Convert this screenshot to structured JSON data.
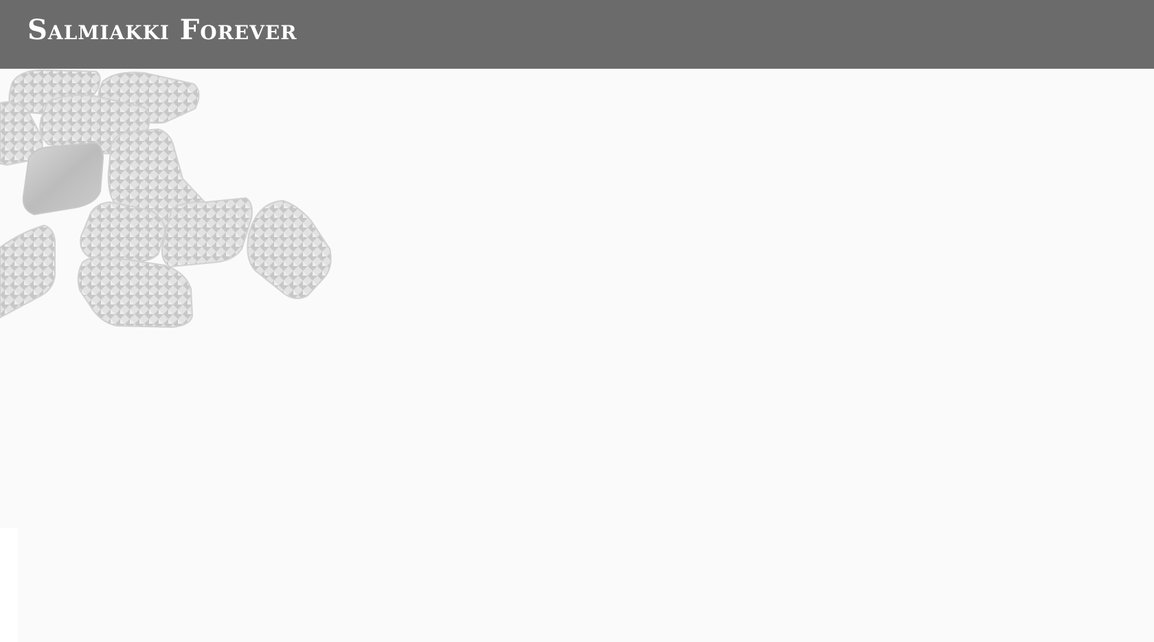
{
  "header": {
    "title": "Salmiakki Forever",
    "background_color": "#6b6b6b",
    "title_color": "#ffffff"
  },
  "main": {
    "background_color": "#fafafa",
    "hero_image": {
      "icon": "salmiakki-candies-image",
      "description_visible": false
    }
  }
}
